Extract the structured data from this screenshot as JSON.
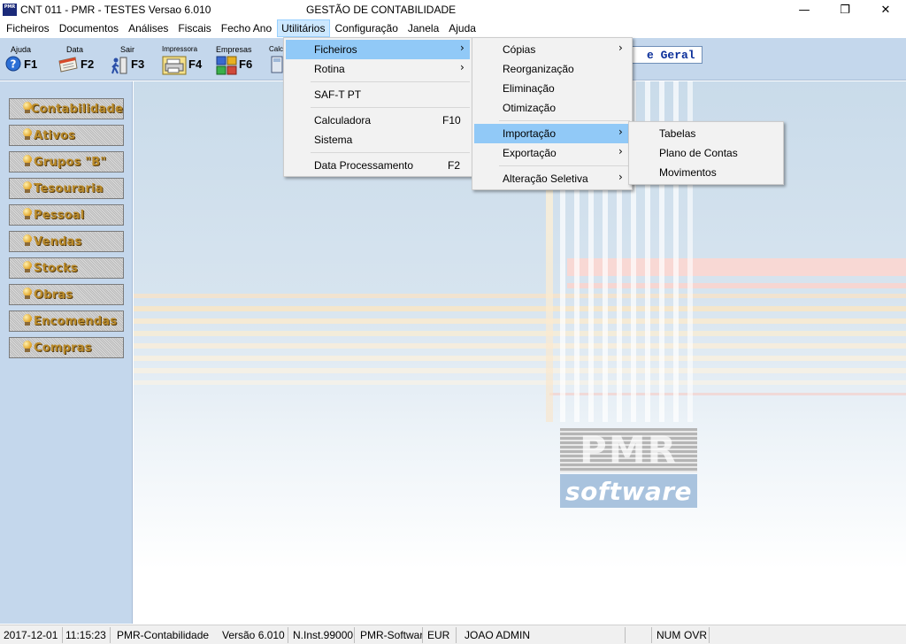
{
  "window": {
    "title": "CNT 011 - PMR - TESTES Versao 6.010",
    "center_title": "GESTÃO DE CONTABILIDADE",
    "app_icon_text": "PMR",
    "minimize_glyph": "—",
    "maximize_glyph": "❐",
    "close_glyph": "✕"
  },
  "menubar": [
    {
      "label": "Ficheiros"
    },
    {
      "label": "Documentos"
    },
    {
      "label": "Análises"
    },
    {
      "label": "Fiscais"
    },
    {
      "label": "Fecho Ano"
    },
    {
      "label": "Utilitários",
      "active": true
    },
    {
      "label": "Configuração"
    },
    {
      "label": "Janela"
    },
    {
      "label": "Ajuda"
    }
  ],
  "toolbar": [
    {
      "label": "Ajuda",
      "key": "F1",
      "icon": "help-icon"
    },
    {
      "label": "Data",
      "key": "F2",
      "icon": "calendar-icon"
    },
    {
      "label": "Sair",
      "key": "F3",
      "icon": "exit-icon"
    },
    {
      "label": "Impressora",
      "key": "F4",
      "icon": "printer-icon"
    },
    {
      "label": "Empresas",
      "key": "F6",
      "icon": "companies-icon"
    },
    {
      "label": "Calc",
      "key": "",
      "icon": "calculator-icon"
    }
  ],
  "summary_box": {
    "text": "e Geral"
  },
  "sidebar": [
    {
      "label": "Contabilidade"
    },
    {
      "label": "Ativos"
    },
    {
      "label": "Grupos \"B\""
    },
    {
      "label": "Tesouraria"
    },
    {
      "label": "Pessoal"
    },
    {
      "label": "Vendas"
    },
    {
      "label": "Stocks"
    },
    {
      "label": "Obras"
    },
    {
      "label": "Encomendas"
    },
    {
      "label": "Compras"
    }
  ],
  "menu_utilitarios": [
    {
      "label": "Ficheiros",
      "shortcut": "",
      "submenu": true,
      "highlighted": true
    },
    {
      "label": "Rotina",
      "shortcut": "",
      "submenu": true
    },
    {
      "label": "SAF-T PT",
      "shortcut": ""
    },
    {
      "label": "Calculadora",
      "shortcut": "F10"
    },
    {
      "label": "Sistema",
      "shortcut": ""
    },
    {
      "label": "Data Processamento",
      "shortcut": "F2"
    }
  ],
  "menu_ficheiros": [
    {
      "label": "Cópias",
      "submenu": true
    },
    {
      "label": "Reorganização"
    },
    {
      "label": "Eliminação"
    },
    {
      "label": "Otimização"
    },
    {
      "label": "Importação",
      "submenu": true,
      "highlighted": true
    },
    {
      "label": "Exportação",
      "submenu": true
    },
    {
      "label": "Alteração Seletiva",
      "submenu": true
    }
  ],
  "menu_importacao": [
    {
      "label": "Tabelas"
    },
    {
      "label": "Plano de Contas"
    },
    {
      "label": "Movimentos"
    }
  ],
  "logo": {
    "top_text": "PMR",
    "bottom_text": "software"
  },
  "statusbar": {
    "date": "2017-12-01",
    "time": "11:15:23",
    "module": "PMR-Contabilidade",
    "version": "Versão  6.010",
    "installation": "N.Inst.99000",
    "company": "PMR-Software",
    "currency": "EUR",
    "user": "JOAO ADMIN",
    "num": "NUM",
    "ovr": "OVR"
  },
  "submenu_arrow": "›",
  "colors": {
    "accent": "#91c9f7",
    "sidebar": "#c4d7ec",
    "summary_text": "#0b2f9a"
  }
}
